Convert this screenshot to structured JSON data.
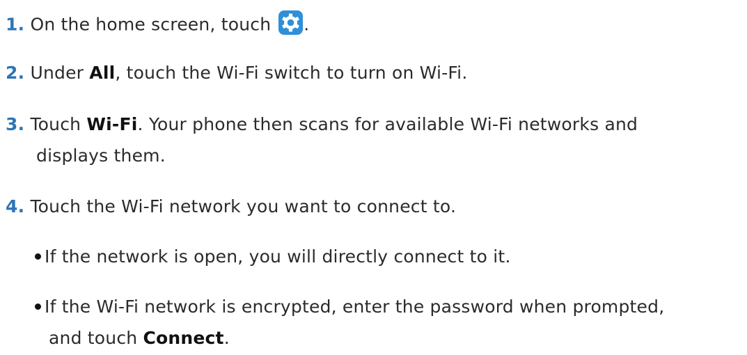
{
  "steps": [
    {
      "number": "1.",
      "text_before": "On the home screen, touch",
      "icon": "settings-gear-icon",
      "text_after": "."
    },
    {
      "number": "2.",
      "text_before": "Under ",
      "bold": "All",
      "text_after": ", touch the Wi-Fi switch to turn on Wi-Fi."
    },
    {
      "number": "3.",
      "text_before": "Touch ",
      "bold": "Wi-Fi",
      "text_after": ". Your phone then scans for available Wi-Fi networks and",
      "continuation": "displays them."
    },
    {
      "number": "4.",
      "text": "Touch the Wi-Fi network you want to connect to."
    }
  ],
  "bullets": [
    {
      "text": "If the network is open, you will directly connect to it."
    },
    {
      "text": "If the Wi-Fi network is encrypted, enter the password when prompted,",
      "continuation_before": "and touch ",
      "bold": "Connect",
      "continuation_after": "."
    }
  ],
  "colors": {
    "step_number": "#2e75b6",
    "text": "#2b2b2b",
    "icon_background": "#2f8fd8"
  }
}
